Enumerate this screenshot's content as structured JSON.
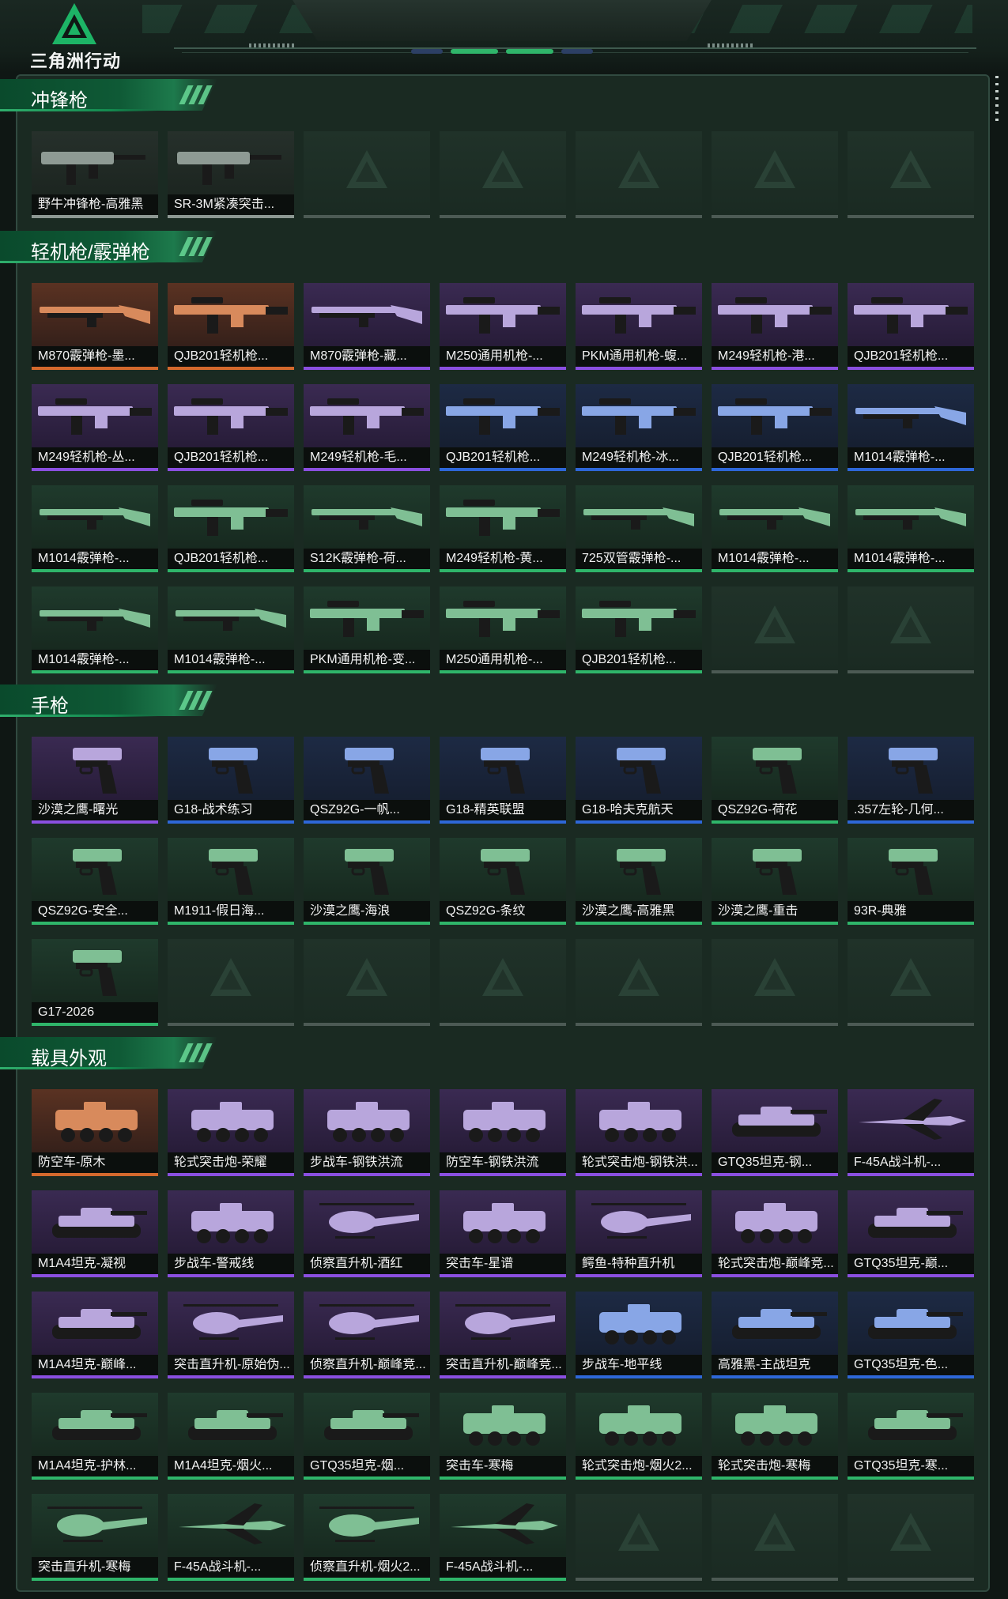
{
  "app": {
    "logo_text": "三角洲行动",
    "accent": "#1e8f55"
  },
  "quality_colors": {
    "gray": "#8d9893",
    "green": "#2fb56a",
    "blue": "#2e67d8",
    "purple": "#8a4fe0",
    "orange": "#d4692d",
    "empty": "#4c5a54"
  },
  "sections": [
    {
      "title": "冲锋枪",
      "rows": [
        [
          {
            "name": "野牛冲锋枪-高雅黑",
            "q": "gray",
            "icon": "smg-icon"
          },
          {
            "name": "SR-3M紧凑突击...",
            "q": "gray",
            "icon": "smg-icon"
          },
          {
            "name": "",
            "q": "empty"
          },
          {
            "name": "",
            "q": "empty"
          },
          {
            "name": "",
            "q": "empty"
          },
          {
            "name": "",
            "q": "empty"
          },
          {
            "name": "",
            "q": "empty"
          }
        ]
      ]
    },
    {
      "title": "轻机枪/霰弹枪",
      "rows": [
        [
          {
            "name": "M870霰弹枪-墨...",
            "q": "orange",
            "icon": "shotgun-icon"
          },
          {
            "name": "QJB201轻机枪...",
            "q": "orange",
            "icon": "lmg-icon"
          },
          {
            "name": "M870霰弹枪-藏...",
            "q": "purple",
            "icon": "shotgun-icon"
          },
          {
            "name": "M250通用机枪-...",
            "q": "purple",
            "icon": "lmg-icon"
          },
          {
            "name": "PKM通用机枪-蝮...",
            "q": "purple",
            "icon": "lmg-icon"
          },
          {
            "name": "M249轻机枪-港...",
            "q": "purple",
            "icon": "lmg-icon"
          },
          {
            "name": "QJB201轻机枪...",
            "q": "purple",
            "icon": "lmg-icon"
          }
        ],
        [
          {
            "name": "M249轻机枪-丛...",
            "q": "purple",
            "icon": "lmg-icon"
          },
          {
            "name": "QJB201轻机枪...",
            "q": "purple",
            "icon": "lmg-icon"
          },
          {
            "name": "M249轻机枪-毛...",
            "q": "purple",
            "icon": "lmg-icon"
          },
          {
            "name": "QJB201轻机枪...",
            "q": "blue",
            "icon": "lmg-icon"
          },
          {
            "name": "M249轻机枪-冰...",
            "q": "blue",
            "icon": "lmg-icon"
          },
          {
            "name": "QJB201轻机枪...",
            "q": "blue",
            "icon": "lmg-icon"
          },
          {
            "name": "M1014霰弹枪-...",
            "q": "blue",
            "icon": "shotgun-icon"
          }
        ],
        [
          {
            "name": "M1014霰弹枪-...",
            "q": "green",
            "icon": "shotgun-icon"
          },
          {
            "name": "QJB201轻机枪...",
            "q": "green",
            "icon": "lmg-icon"
          },
          {
            "name": "S12K霰弹枪-荷...",
            "q": "green",
            "icon": "shotgun-icon"
          },
          {
            "name": "M249轻机枪-黄...",
            "q": "green",
            "icon": "lmg-icon"
          },
          {
            "name": "725双管霰弹枪-...",
            "q": "green",
            "icon": "shotgun-icon"
          },
          {
            "name": "M1014霰弹枪-...",
            "q": "green",
            "icon": "shotgun-icon"
          },
          {
            "name": "M1014霰弹枪-...",
            "q": "green",
            "icon": "shotgun-icon"
          }
        ],
        [
          {
            "name": "M1014霰弹枪-...",
            "q": "green",
            "icon": "shotgun-icon"
          },
          {
            "name": "M1014霰弹枪-...",
            "q": "green",
            "icon": "shotgun-icon"
          },
          {
            "name": "PKM通用机枪-变...",
            "q": "green",
            "icon": "lmg-icon"
          },
          {
            "name": "M250通用机枪-...",
            "q": "green",
            "icon": "lmg-icon"
          },
          {
            "name": "QJB201轻机枪...",
            "q": "green",
            "icon": "lmg-icon"
          },
          {
            "name": "",
            "q": "empty"
          },
          {
            "name": "",
            "q": "empty"
          }
        ]
      ]
    },
    {
      "title": "手枪",
      "rows": [
        [
          {
            "name": "沙漠之鹰-曙光",
            "q": "purple",
            "icon": "pistol-icon"
          },
          {
            "name": "G18-战术练习",
            "q": "blue",
            "icon": "pistol-icon"
          },
          {
            "name": "QSZ92G-一帆...",
            "q": "blue",
            "icon": "pistol-icon"
          },
          {
            "name": "G18-精英联盟",
            "q": "blue",
            "icon": "pistol-icon"
          },
          {
            "name": "G18-哈夫克航天",
            "q": "blue",
            "icon": "pistol-icon"
          },
          {
            "name": "QSZ92G-荷花",
            "q": "green",
            "icon": "pistol-icon"
          },
          {
            "name": ".357左轮-几何...",
            "q": "blue",
            "icon": "revolver-icon"
          }
        ],
        [
          {
            "name": "QSZ92G-安全...",
            "q": "green",
            "icon": "pistol-icon"
          },
          {
            "name": "M1911-假日海...",
            "q": "green",
            "icon": "pistol-icon"
          },
          {
            "name": "沙漠之鹰-海浪",
            "q": "green",
            "icon": "pistol-icon"
          },
          {
            "name": "QSZ92G-条纹",
            "q": "green",
            "icon": "pistol-icon"
          },
          {
            "name": "沙漠之鹰-高雅黑",
            "q": "green",
            "icon": "pistol-icon"
          },
          {
            "name": "沙漠之鹰-重击",
            "q": "green",
            "icon": "pistol-icon"
          },
          {
            "name": "93R-典雅",
            "q": "green",
            "icon": "pistol-icon"
          }
        ],
        [
          {
            "name": "G17-2026",
            "q": "green",
            "icon": "pistol-icon"
          },
          {
            "name": "",
            "q": "empty"
          },
          {
            "name": "",
            "q": "empty"
          },
          {
            "name": "",
            "q": "empty"
          },
          {
            "name": "",
            "q": "empty"
          },
          {
            "name": "",
            "q": "empty"
          },
          {
            "name": "",
            "q": "empty"
          }
        ]
      ]
    },
    {
      "title": "载具外观",
      "rows": [
        [
          {
            "name": "防空车-原木",
            "q": "orange",
            "icon": "apc-icon"
          },
          {
            "name": "轮式突击炮-荣耀",
            "q": "purple",
            "icon": "apc-icon"
          },
          {
            "name": "步战车-钢铁洪流",
            "q": "purple",
            "icon": "apc-icon"
          },
          {
            "name": "防空车-钢铁洪流",
            "q": "purple",
            "icon": "apc-icon"
          },
          {
            "name": "轮式突击炮-钢铁洪...",
            "q": "purple",
            "icon": "apc-icon"
          },
          {
            "name": "GTQ35坦克-钢...",
            "q": "purple",
            "icon": "tank-icon"
          },
          {
            "name": "F-45A战斗机-...",
            "q": "purple",
            "icon": "jet-icon"
          }
        ],
        [
          {
            "name": "M1A4坦克-凝视",
            "q": "purple",
            "icon": "tank-icon"
          },
          {
            "name": "步战车-警戒线",
            "q": "purple",
            "icon": "apc-icon"
          },
          {
            "name": "侦察直升机-酒红",
            "q": "purple",
            "icon": "helicopter-icon"
          },
          {
            "name": "突击车-星谱",
            "q": "purple",
            "icon": "apc-icon"
          },
          {
            "name": "鳄鱼-特种直升机",
            "q": "purple",
            "icon": "helicopter-icon"
          },
          {
            "name": "轮式突击炮-巅峰竞...",
            "q": "purple",
            "icon": "apc-icon"
          },
          {
            "name": "GTQ35坦克-巅...",
            "q": "purple",
            "icon": "tank-icon"
          }
        ],
        [
          {
            "name": "M1A4坦克-巅峰...",
            "q": "purple",
            "icon": "tank-icon"
          },
          {
            "name": "突击直升机-原始伪...",
            "q": "purple",
            "icon": "helicopter-icon"
          },
          {
            "name": "侦察直升机-巅峰竞...",
            "q": "purple",
            "icon": "helicopter-icon"
          },
          {
            "name": "突击直升机-巅峰竞...",
            "q": "purple",
            "icon": "helicopter-icon"
          },
          {
            "name": "步战车-地平线",
            "q": "blue",
            "icon": "apc-icon"
          },
          {
            "name": "高雅黑-主战坦克",
            "q": "blue",
            "icon": "tank-icon"
          },
          {
            "name": "GTQ35坦克-色...",
            "q": "blue",
            "icon": "tank-icon"
          }
        ],
        [
          {
            "name": "M1A4坦克-护林...",
            "q": "green",
            "icon": "tank-icon"
          },
          {
            "name": "M1A4坦克-烟火...",
            "q": "green",
            "icon": "tank-icon"
          },
          {
            "name": "GTQ35坦克-烟...",
            "q": "green",
            "icon": "tank-icon"
          },
          {
            "name": "突击车-寒梅",
            "q": "green",
            "icon": "apc-icon"
          },
          {
            "name": "轮式突击炮-烟火2...",
            "q": "green",
            "icon": "apc-icon"
          },
          {
            "name": "轮式突击炮-寒梅",
            "q": "green",
            "icon": "apc-icon"
          },
          {
            "name": "GTQ35坦克-寒...",
            "q": "green",
            "icon": "tank-icon"
          }
        ],
        [
          {
            "name": "突击直升机-寒梅",
            "q": "green",
            "icon": "helicopter-icon"
          },
          {
            "name": "F-45A战斗机-...",
            "q": "green",
            "icon": "jet-icon"
          },
          {
            "name": "侦察直升机-烟火2...",
            "q": "green",
            "icon": "helicopter-icon"
          },
          {
            "name": "F-45A战斗机-...",
            "q": "green",
            "icon": "jet-icon"
          },
          {
            "name": "",
            "q": "empty"
          },
          {
            "name": "",
            "q": "empty"
          },
          {
            "name": "",
            "q": "empty"
          }
        ]
      ]
    }
  ]
}
